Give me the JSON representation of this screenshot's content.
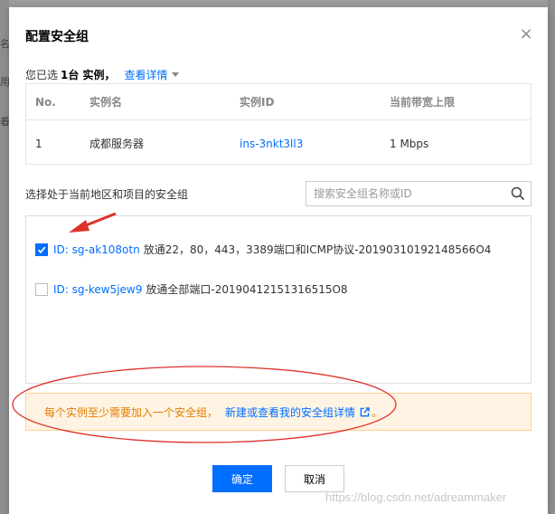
{
  "background": {
    "left_fragments": [
      "名",
      "用",
      "着"
    ]
  },
  "dialog": {
    "title": "配置安全组",
    "close_glyph": "×"
  },
  "summary": {
    "prefix": "您已选",
    "count": "1台 实例，",
    "link": "查看详情"
  },
  "instance_table": {
    "headers": [
      "No.",
      "实例名",
      "实例ID",
      "当前带宽上限"
    ],
    "rows": [
      {
        "no": "1",
        "name": "成都服务器",
        "id": "ins-3nkt3ll3",
        "bandwidth": "1 Mbps"
      }
    ]
  },
  "security_group": {
    "label": "选择处于当前地区和项目的安全组",
    "search_placeholder": "搜索安全组名称或ID",
    "items": [
      {
        "checked": true,
        "id": "ID: sg-ak108otn",
        "desc": "放通22，80，443，3389端口和ICMP协议-20190310192148566O4"
      },
      {
        "checked": false,
        "id": "ID: sg-kew5jew9",
        "desc": "放通全部端口-20190412151316515O8"
      }
    ]
  },
  "notice": {
    "text": "每个实例至少需要加入一个安全组，",
    "link": "新建或查看我的安全组详情",
    "period": "。"
  },
  "buttons": {
    "ok": "确定",
    "cancel": "取消"
  },
  "watermark": "https://blog.csdn.net/adreammaker",
  "colors": {
    "accent": "#006eff",
    "warning_text": "#e37c00",
    "warning_bg": "#fff4e3",
    "annotation_red": "#e0322b"
  }
}
